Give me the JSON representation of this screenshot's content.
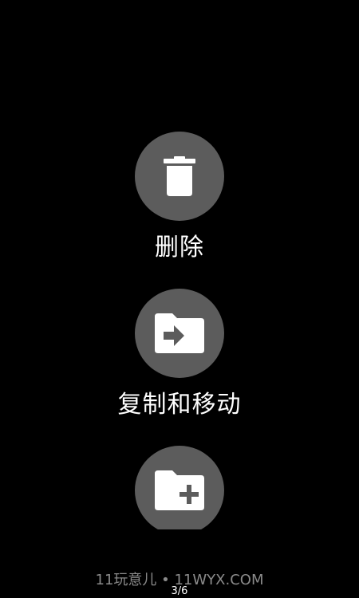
{
  "theme": {
    "background": "#000000",
    "button_fill": "#5c5c5c",
    "icon_color": "#ffffff",
    "label_color": "#ffffff",
    "watermark_color": "#8a8a8a"
  },
  "actions": [
    {
      "id": "delete",
      "icon": "trash-icon",
      "label": "删除"
    },
    {
      "id": "copy-move",
      "icon": "folder-move-icon",
      "label": "复制和移动"
    },
    {
      "id": "new-folder",
      "icon": "folder-add-icon",
      "label": ""
    }
  ],
  "watermark": "11玩意儿 • 11WYX.COM",
  "page_indicator": "3/6"
}
